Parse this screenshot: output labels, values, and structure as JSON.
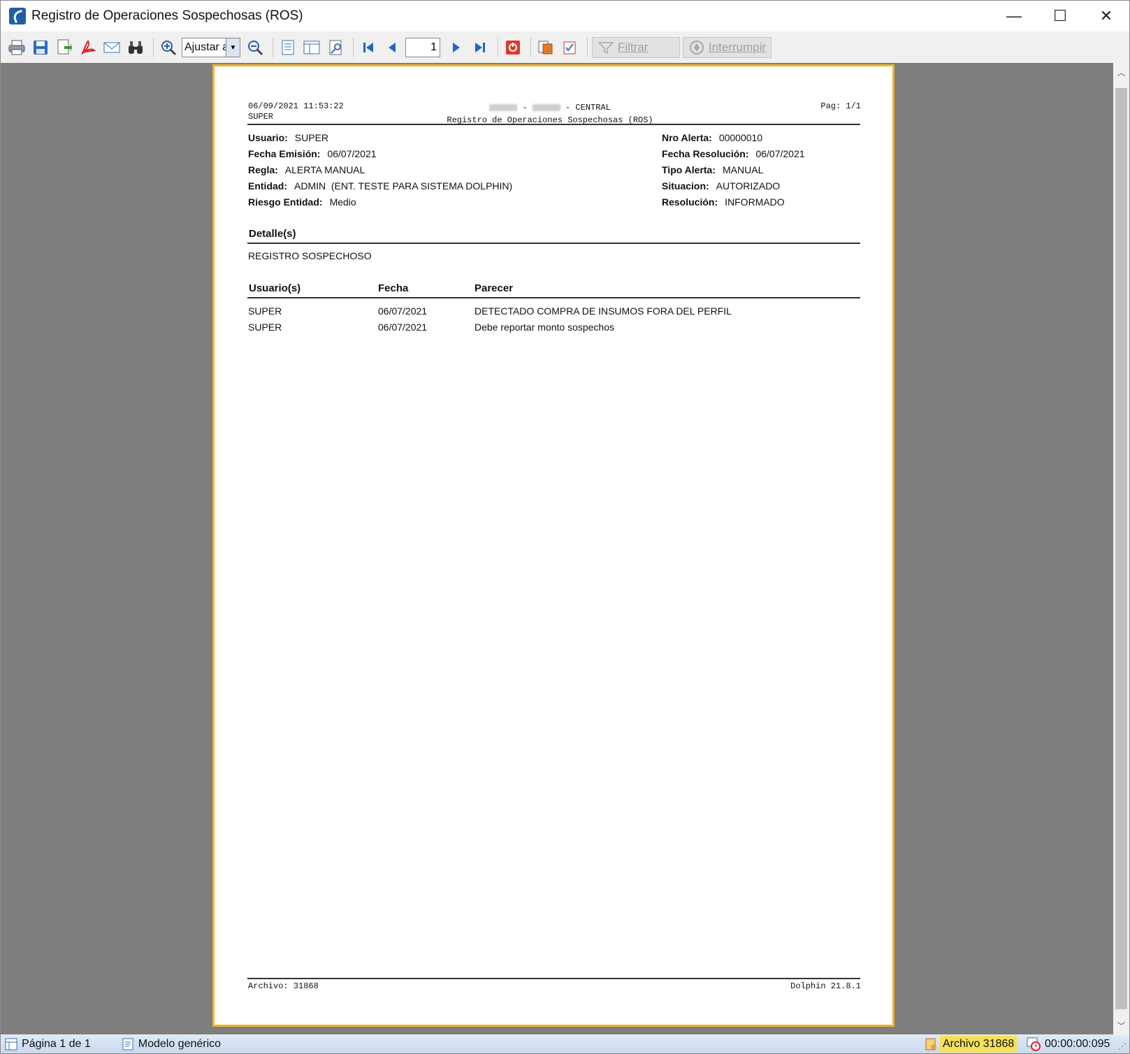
{
  "window": {
    "title": "Registro de Operaciones Sospechosas (ROS)",
    "minimize": "—",
    "maximize": "☐",
    "close": "✕"
  },
  "toolbar": {
    "zoom_value": "Ajustar a",
    "page_value": "1",
    "filter_label": "Filtrar",
    "interrupt_label": "Interrumpir"
  },
  "report": {
    "header": {
      "datetime": "06/09/2021 11:53:22",
      "user": "SUPER",
      "branch": "CENTRAL",
      "title": "Registro de Operaciones Sospechosas (ROS)",
      "page": "Pag: 1/1"
    },
    "fields_left": [
      {
        "label": "Usuario:",
        "value": "SUPER"
      },
      {
        "label": "Fecha Emisión:",
        "value": "06/07/2021"
      },
      {
        "label": "Regla:",
        "value": "ALERTA MANUAL"
      },
      {
        "label": "Entidad:",
        "value": "ADMIN  (ENT. TESTE PARA SISTEMA DOLPHIN)"
      },
      {
        "label": "Riesgo Entidad:",
        "value": "Medio"
      }
    ],
    "fields_right": [
      {
        "label": "Nro Alerta:",
        "value": "00000010"
      },
      {
        "label": "Fecha Resolución:",
        "value": "06/07/2021"
      },
      {
        "label": "Tipo Alerta:",
        "value": "MANUAL"
      },
      {
        "label": "Situacion:",
        "value": "AUTORIZADO"
      },
      {
        "label": "Resolución:",
        "value": "INFORMADO"
      }
    ],
    "detail_title": "Detalle(s)",
    "detail_text": "REGISTRO SOSPECHOSO",
    "table": {
      "columns": [
        "Usuario(s)",
        "Fecha",
        "Parecer"
      ],
      "rows": [
        [
          "SUPER",
          "06/07/2021",
          "DETECTADO COMPRA DE INSUMOS FORA DEL PERFIL"
        ],
        [
          "SUPER",
          "06/07/2021",
          "Debe reportar monto sospechos"
        ]
      ]
    },
    "footer": {
      "archivo": "Archivo: 31868",
      "version": "Dolphin 21.8.1"
    }
  },
  "statusbar": {
    "page_info": "Página 1 de 1",
    "model": "Modelo genérico",
    "archivo": "Archivo 31868",
    "elapsed": "00:00:00:095"
  }
}
